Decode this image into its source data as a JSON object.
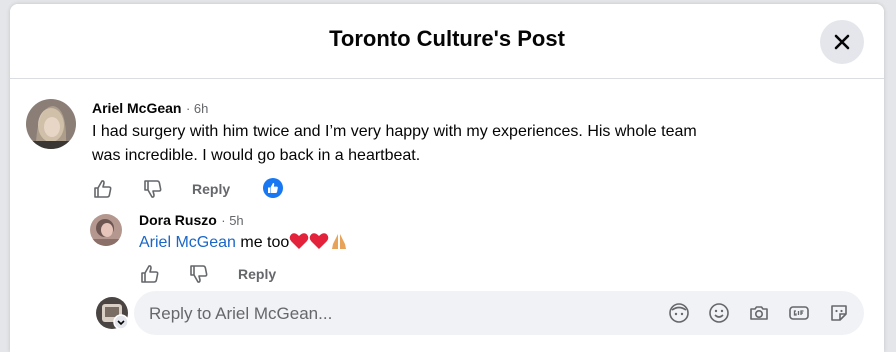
{
  "dialog": {
    "title": "Toronto Culture's Post"
  },
  "comment": {
    "author": "Ariel McGean",
    "time": "· 6h",
    "text_line1": "I had surgery with him twice and I’m very happy with my experiences. His whole team",
    "text_line2": "was incredible. I would go back in a heartbeat.",
    "reply_label": "Reply",
    "reaction": "like"
  },
  "reply": {
    "author": "Dora Ruszo",
    "time": "· 5h",
    "mention": "Ariel McGean",
    "text": " me too",
    "emojis": [
      "red-heart",
      "red-heart",
      "folded-hands"
    ],
    "reply_label": "Reply"
  },
  "composer": {
    "placeholder": "Reply to Ariel McGean...",
    "tools": [
      "avatar-sticker-icon",
      "emoji-icon",
      "camera-icon",
      "gif-icon",
      "sticker-icon"
    ]
  },
  "colors": {
    "accent": "#1b67c6",
    "like_blue": "#1877f2",
    "muted": "#65676b"
  }
}
